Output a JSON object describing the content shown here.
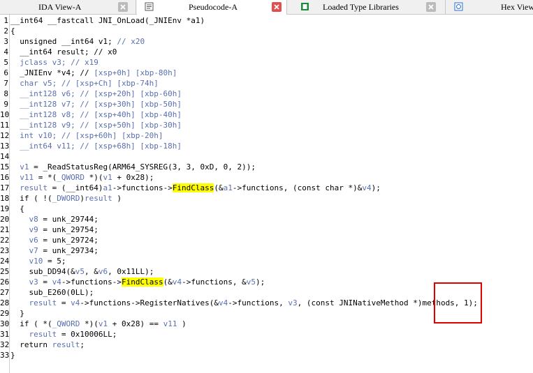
{
  "tabs": [
    {
      "label": "IDA View-A",
      "icon": "ida-view-icon",
      "active": false,
      "closable": true
    },
    {
      "label": "Pseudocode-A",
      "icon": "pseudocode-icon",
      "active": true,
      "closable": true
    },
    {
      "label": "Loaded Type Libraries",
      "icon": "type-libraries-icon",
      "active": false,
      "closable": true
    },
    {
      "label": "Hex View",
      "icon": "hex-view-icon",
      "active": false,
      "closable": false
    }
  ],
  "colors": {
    "close_active": "#e05050",
    "highlight": "#ffff00",
    "var": "#5a6fb0",
    "annotation": "#e00000"
  },
  "lines": [
    {
      "n": "1",
      "segs": [
        [
          "t",
          "__int64 __fastcall JNI_OnLoad(_JNIEnv *a1)"
        ]
      ]
    },
    {
      "n": "2",
      "segs": [
        [
          "t",
          "{"
        ]
      ]
    },
    {
      "n": "3",
      "segs": [
        [
          "t",
          "  unsigned __int64 v1; "
        ],
        [
          "c",
          "// x20"
        ]
      ]
    },
    {
      "n": "4",
      "segs": [
        [
          "t",
          "  __int64 result; // x0"
        ]
      ]
    },
    {
      "n": "5",
      "segs": [
        [
          "c",
          "  jclass v3; // x19"
        ]
      ]
    },
    {
      "n": "6",
      "segs": [
        [
          "t",
          "  _JNIEnv *v4; // "
        ],
        [
          "c",
          "[xsp+0h] [xbp-80h]"
        ]
      ]
    },
    {
      "n": "7",
      "segs": [
        [
          "c",
          "  char v5; // [xsp+Ch] [xbp-74h]"
        ]
      ]
    },
    {
      "n": "8",
      "segs": [
        [
          "c",
          "  __int128 v6; // [xsp+20h] [xbp-60h]"
        ]
      ]
    },
    {
      "n": "9",
      "segs": [
        [
          "c",
          "  __int128 v7; // [xsp+30h] [xbp-50h]"
        ]
      ]
    },
    {
      "n": "10",
      "segs": [
        [
          "c",
          "  __int128 v8; // [xsp+40h] [xbp-40h]"
        ]
      ]
    },
    {
      "n": "11",
      "segs": [
        [
          "c",
          "  __int128 v9; // [xsp+50h] [xbp-30h]"
        ]
      ]
    },
    {
      "n": "12",
      "segs": [
        [
          "c",
          "  int v10; // [xsp+60h] [xbp-20h]"
        ]
      ]
    },
    {
      "n": "13",
      "segs": [
        [
          "c",
          "  __int64 v11; // [xsp+68h] [xbp-18h]"
        ]
      ]
    },
    {
      "n": "14",
      "segs": [
        [
          "t",
          ""
        ]
      ]
    },
    {
      "n": "15",
      "segs": [
        [
          "v",
          "  v1"
        ],
        [
          "t",
          " = _ReadStatusReg(ARM64_SYSREG(3, 3, 0xD, 0, 2));"
        ]
      ]
    },
    {
      "n": "16",
      "segs": [
        [
          "v",
          "  v11"
        ],
        [
          "t",
          " = *("
        ],
        [
          "v",
          "_QWORD"
        ],
        [
          "t",
          " *)("
        ],
        [
          "v",
          "v1"
        ],
        [
          "t",
          " + 0x28);"
        ]
      ]
    },
    {
      "n": "17",
      "segs": [
        [
          "v",
          "  result"
        ],
        [
          "t",
          " = (__int64)"
        ],
        [
          "v",
          "a1"
        ],
        [
          "t",
          "->functions->"
        ],
        [
          "h",
          "FindClass"
        ],
        [
          "t",
          "(&"
        ],
        [
          "v",
          "a1"
        ],
        [
          "t",
          "->functions, (const char *)&"
        ],
        [
          "v",
          "v4"
        ],
        [
          "t",
          ");"
        ]
      ]
    },
    {
      "n": "18",
      "segs": [
        [
          "t",
          "  if ( !("
        ],
        [
          "v",
          "_DWORD"
        ],
        [
          "t",
          ")"
        ],
        [
          "v",
          "result"
        ],
        [
          "t",
          " )"
        ]
      ]
    },
    {
      "n": "19",
      "segs": [
        [
          "t",
          "  {"
        ]
      ]
    },
    {
      "n": "20",
      "segs": [
        [
          "v",
          "    v8"
        ],
        [
          "t",
          " = unk_29744;"
        ]
      ]
    },
    {
      "n": "21",
      "segs": [
        [
          "v",
          "    v9"
        ],
        [
          "t",
          " = unk_29754;"
        ]
      ]
    },
    {
      "n": "22",
      "segs": [
        [
          "v",
          "    v6"
        ],
        [
          "t",
          " = unk_29724;"
        ]
      ]
    },
    {
      "n": "23",
      "segs": [
        [
          "v",
          "    v7"
        ],
        [
          "t",
          " = unk_29734;"
        ]
      ]
    },
    {
      "n": "24",
      "segs": [
        [
          "v",
          "    v10"
        ],
        [
          "t",
          " = 5;"
        ]
      ]
    },
    {
      "n": "25",
      "segs": [
        [
          "t",
          "    sub_DD94(&"
        ],
        [
          "v",
          "v5"
        ],
        [
          "t",
          ", &"
        ],
        [
          "v",
          "v6"
        ],
        [
          "t",
          ", 0x11LL);"
        ]
      ]
    },
    {
      "n": "26",
      "segs": [
        [
          "v",
          "    v3"
        ],
        [
          "t",
          " = "
        ],
        [
          "v",
          "v4"
        ],
        [
          "t",
          "->functions->"
        ],
        [
          "h",
          "FindClass"
        ],
        [
          "t",
          "(&"
        ],
        [
          "v",
          "v4"
        ],
        [
          "t",
          "->functions, &"
        ],
        [
          "v",
          "v5"
        ],
        [
          "t",
          ");"
        ]
      ]
    },
    {
      "n": "27",
      "segs": [
        [
          "t",
          "    sub_E260(0LL);"
        ]
      ]
    },
    {
      "n": "28",
      "segs": [
        [
          "v",
          "    result"
        ],
        [
          "t",
          " = "
        ],
        [
          "v",
          "v4"
        ],
        [
          "t",
          "->functions->RegisterNatives(&"
        ],
        [
          "v",
          "v4"
        ],
        [
          "t",
          "->functions, "
        ],
        [
          "v",
          "v3"
        ],
        [
          "t",
          ", (const JNINativeMethod *)methods, 1);"
        ]
      ]
    },
    {
      "n": "29",
      "segs": [
        [
          "t",
          "  }"
        ]
      ]
    },
    {
      "n": "30",
      "segs": [
        [
          "t",
          "  if ( *("
        ],
        [
          "v",
          "_QWORD"
        ],
        [
          "t",
          " *)("
        ],
        [
          "v",
          "v1"
        ],
        [
          "t",
          " + 0x28) == "
        ],
        [
          "v",
          "v11"
        ],
        [
          "t",
          " )"
        ]
      ]
    },
    {
      "n": "31",
      "segs": [
        [
          "v",
          "    result"
        ],
        [
          "t",
          " = 0x10006LL;"
        ]
      ]
    },
    {
      "n": "32",
      "segs": [
        [
          "t",
          "  return "
        ],
        [
          "v",
          "result"
        ],
        [
          "t",
          ";"
        ]
      ]
    },
    {
      "n": "33",
      "segs": [
        [
          "t",
          "}"
        ]
      ]
    }
  ]
}
